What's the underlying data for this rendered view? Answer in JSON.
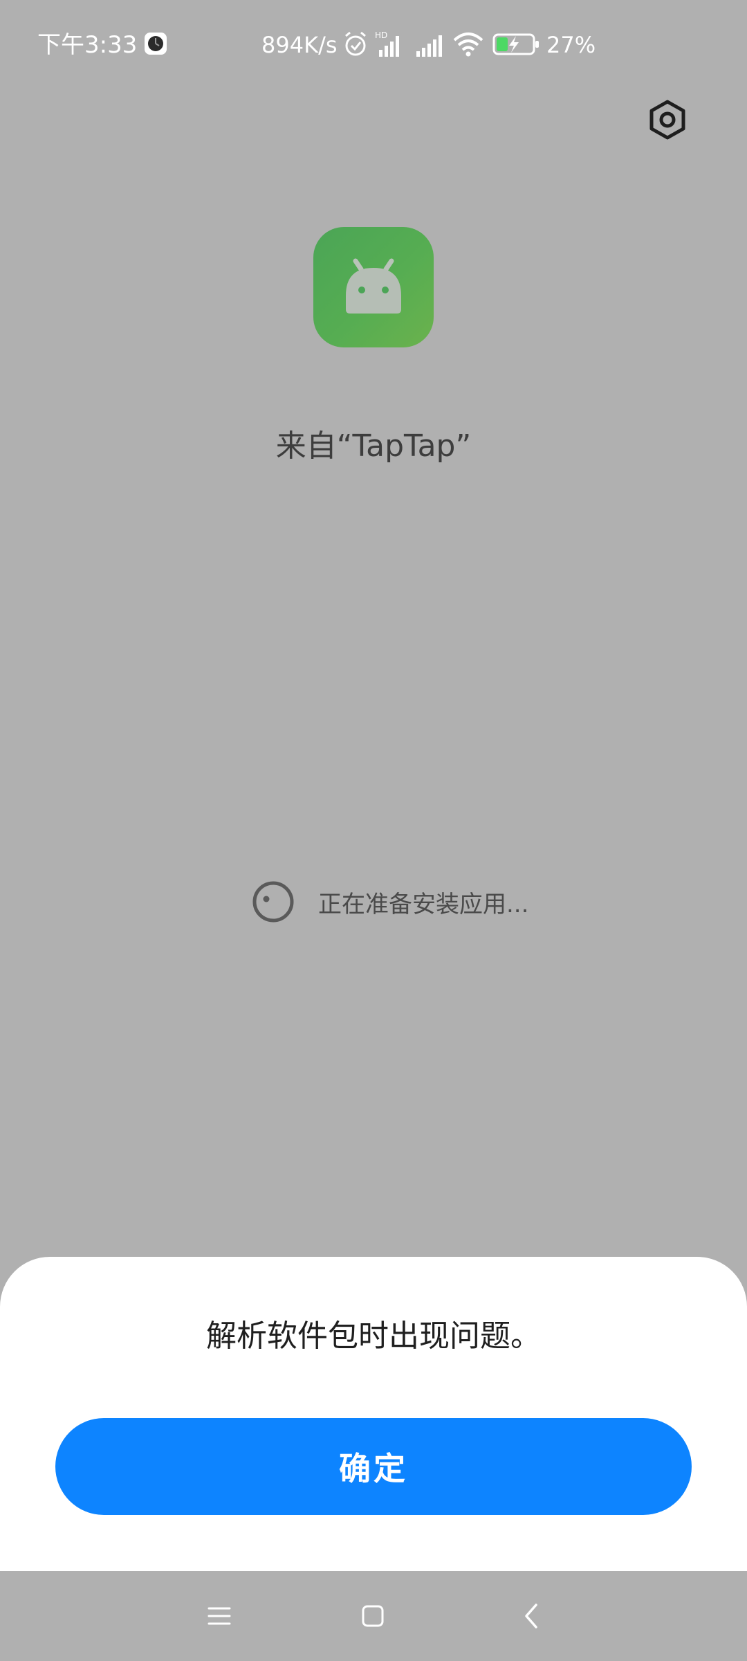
{
  "status_bar": {
    "time": "下午3:33",
    "network_speed": "894K/s",
    "battery_percent": "27%",
    "icons": [
      "app-notification-icon",
      "alarm-icon",
      "hd-signal-icon",
      "signal-icon",
      "wifi-icon",
      "battery-charging-icon"
    ]
  },
  "header": {
    "settings_icon": "settings-hexagon-icon"
  },
  "app": {
    "icon": "android-icon",
    "source_label": "来自“TapTap”"
  },
  "progress": {
    "text": "正在准备安装应用..."
  },
  "dialog": {
    "message": "解析软件包时出现问题。",
    "confirm_label": "确定"
  },
  "nav_bar": {
    "buttons": [
      "menu-icon",
      "home-icon",
      "back-icon"
    ]
  },
  "colors": {
    "background": "#b0b0b0",
    "accent": "#0d84ff",
    "app_icon_green": "#4ba556",
    "battery_green": "#4cd964"
  }
}
